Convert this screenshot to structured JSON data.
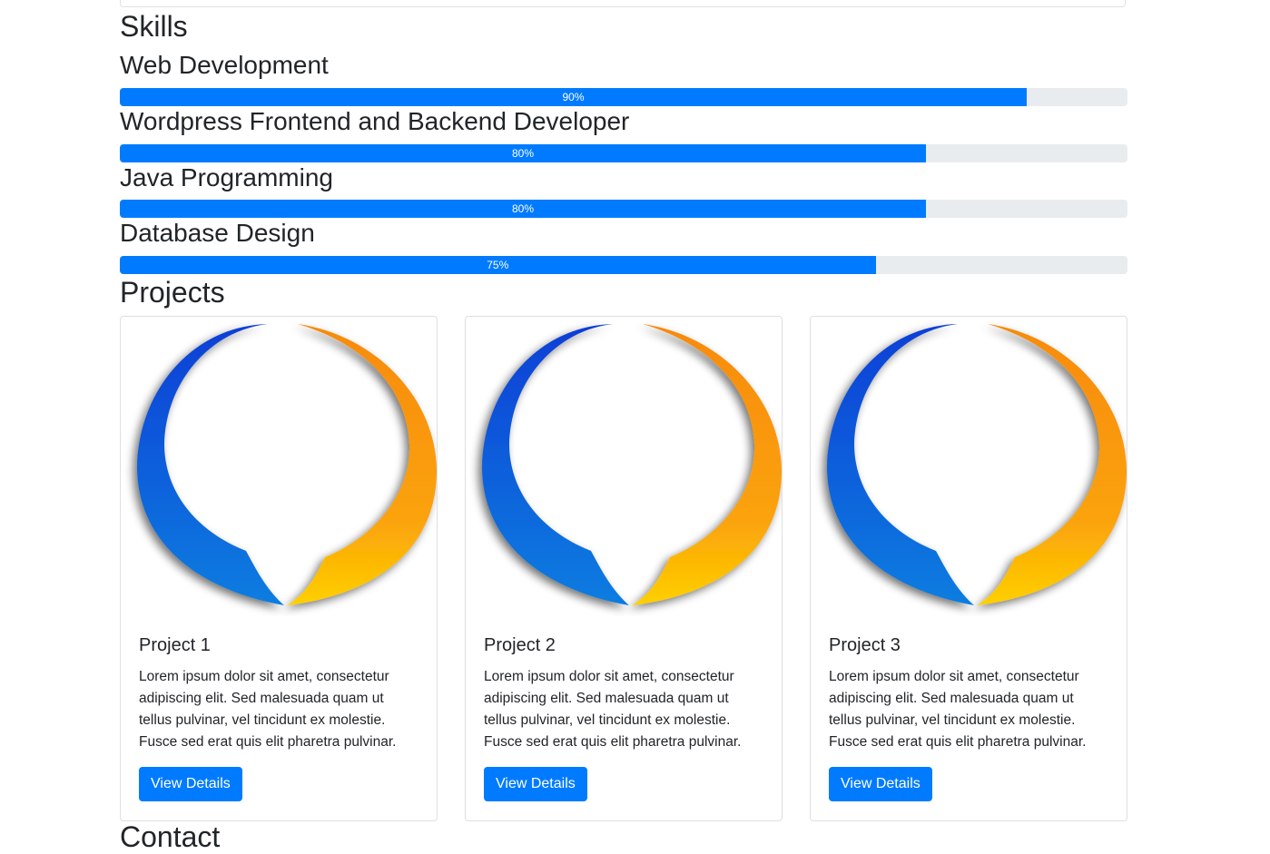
{
  "skills": {
    "heading": "Skills",
    "items": [
      {
        "name": "Web Development",
        "percent": 90,
        "label": "90%"
      },
      {
        "name": "Wordpress Frontend and Backend Developer",
        "percent": 80,
        "label": "80%"
      },
      {
        "name": "Java Programming",
        "percent": 80,
        "label": "80%"
      },
      {
        "name": "Database Design",
        "percent": 75,
        "label": "75%"
      }
    ]
  },
  "projects": {
    "heading": "Projects",
    "items": [
      {
        "title": "Project 1",
        "text": "Lorem ipsum dolor sit amet, consectetur adipiscing elit. Sed malesuada quam ut tellus pulvinar, vel tincidunt ex molestie. Fusce sed erat quis elit pharetra pulvinar.",
        "button": "View Details"
      },
      {
        "title": "Project 2",
        "text": "Lorem ipsum dolor sit amet, consectetur adipiscing elit. Sed malesuada quam ut tellus pulvinar, vel tincidunt ex molestie. Fusce sed erat quis elit pharetra pulvinar.",
        "button": "View Details"
      },
      {
        "title": "Project 3",
        "text": "Lorem ipsum dolor sit amet, consectetur adipiscing elit. Sed malesuada quam ut tellus pulvinar, vel tincidunt ex molestie. Fusce sed erat quis elit pharetra pulvinar.",
        "button": "View Details"
      }
    ],
    "image_icon": "speech-bubble-logo-icon"
  },
  "contact": {
    "heading": "Contact"
  },
  "colors": {
    "primary": "#007bff",
    "track": "#e9ecef",
    "logo_blue": "#0a4fd8",
    "logo_orange": "#f7931e",
    "logo_yellow": "#ffc400"
  }
}
